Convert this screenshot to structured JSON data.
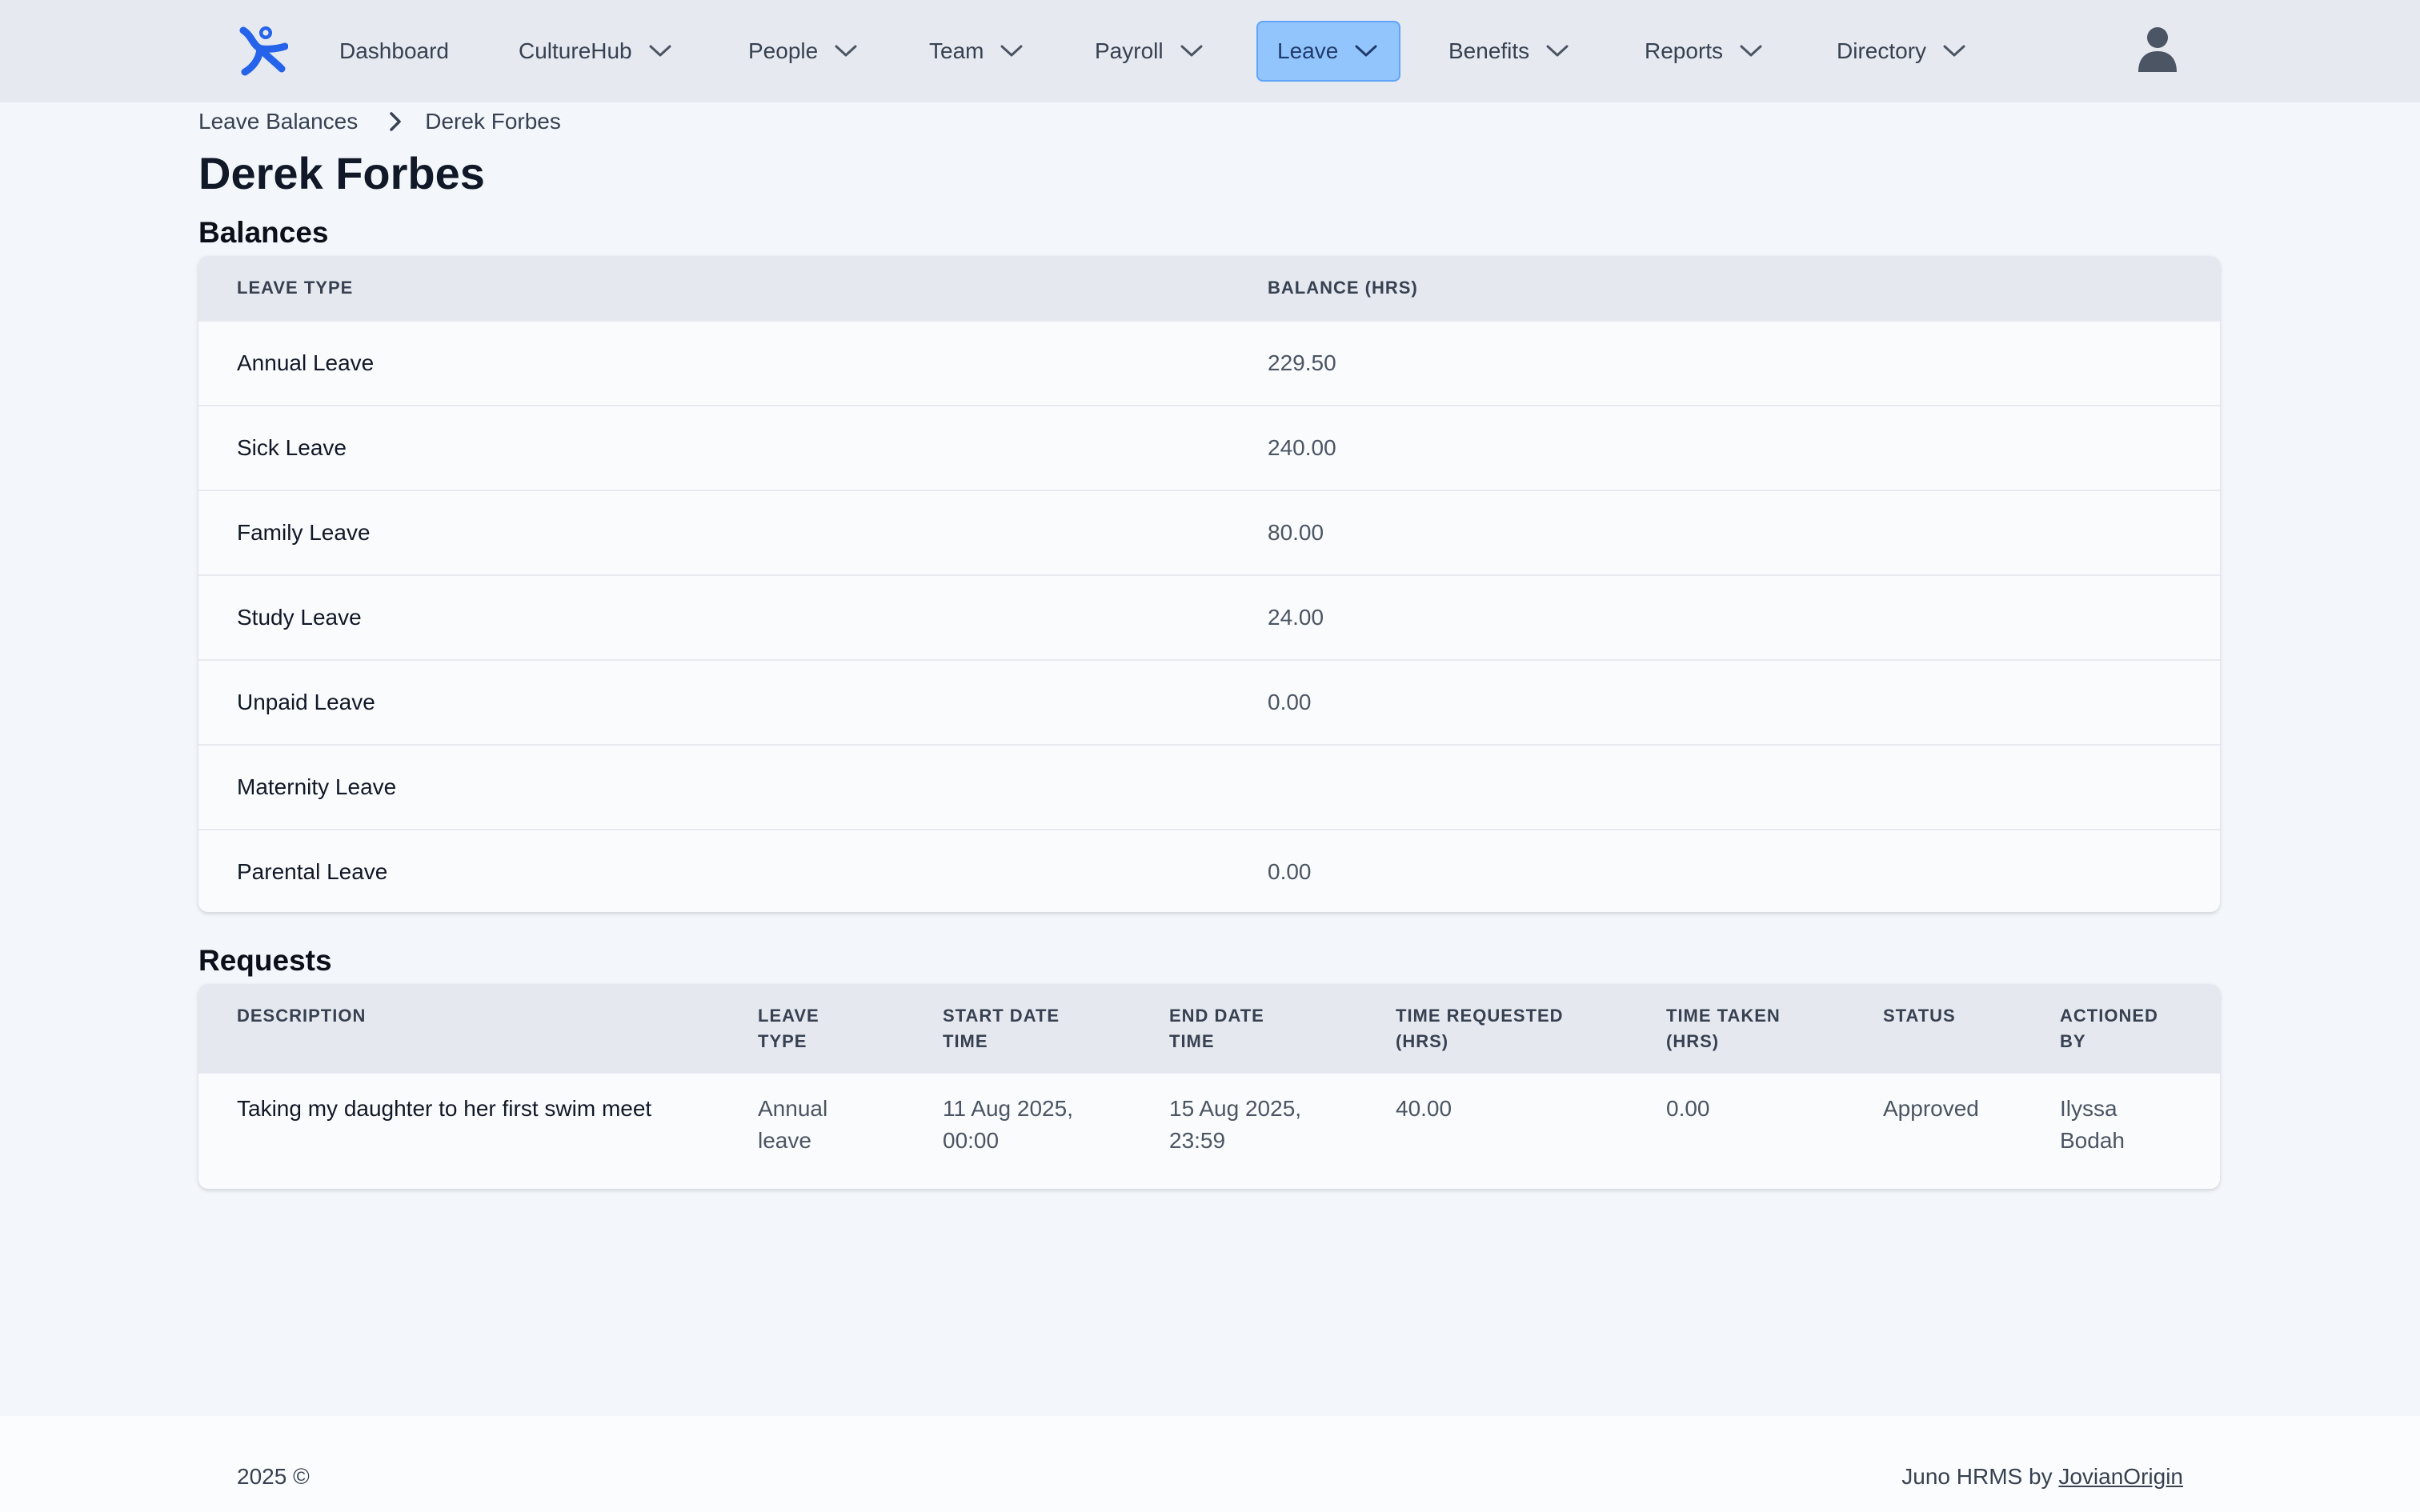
{
  "nav": {
    "items": [
      {
        "label": "Dashboard",
        "dropdown": false,
        "active": false
      },
      {
        "label": "CultureHub",
        "dropdown": true,
        "active": false
      },
      {
        "label": "People",
        "dropdown": true,
        "active": false
      },
      {
        "label": "Team",
        "dropdown": true,
        "active": false
      },
      {
        "label": "Payroll",
        "dropdown": true,
        "active": false
      },
      {
        "label": "Leave",
        "dropdown": true,
        "active": true
      },
      {
        "label": "Benefits",
        "dropdown": true,
        "active": false
      },
      {
        "label": "Reports",
        "dropdown": true,
        "active": false
      },
      {
        "label": "Directory",
        "dropdown": true,
        "active": false
      }
    ],
    "logo_icon": "juno-logo-icon",
    "user_icon": "user-avatar-icon",
    "accent_color": "#93c5fd",
    "brand_color": "#2563eb"
  },
  "breadcrumb": {
    "parent": "Leave Balances",
    "current": "Derek Forbes"
  },
  "page_title": "Derek Forbes",
  "balances": {
    "title": "Balances",
    "headers": {
      "leave_type": "LEAVE TYPE",
      "balance": "BALANCE (HRS)"
    },
    "rows": [
      {
        "type": "Annual Leave",
        "balance": "229.50"
      },
      {
        "type": "Sick Leave",
        "balance": "240.00"
      },
      {
        "type": "Family Leave",
        "balance": "80.00"
      },
      {
        "type": "Study Leave",
        "balance": "24.00"
      },
      {
        "type": "Unpaid Leave",
        "balance": "0.00"
      },
      {
        "type": "Maternity Leave",
        "balance": ""
      },
      {
        "type": "Parental Leave",
        "balance": "0.00"
      }
    ]
  },
  "requests": {
    "title": "Requests",
    "headers": {
      "description": "DESCRIPTION",
      "leave_type_1": "LEAVE",
      "leave_type_2": "TYPE",
      "start_1": "START DATE",
      "start_2": "TIME",
      "end_1": "END DATE",
      "end_2": "TIME",
      "requested_1": "TIME REQUESTED",
      "requested_2": "(HRS)",
      "taken_1": "TIME TAKEN",
      "taken_2": "(HRS)",
      "status": "STATUS",
      "actioned_1": "ACTIONED",
      "actioned_2": "BY"
    },
    "rows": [
      {
        "description": "Taking my daughter to her first swim meet",
        "leave_type_1": "Annual",
        "leave_type_2": "leave",
        "start_1": "11 Aug 2025,",
        "start_2": "00:00",
        "end_1": "15 Aug 2025,",
        "end_2": "23:59",
        "requested": "40.00",
        "taken": "0.00",
        "status": "Approved",
        "actioned_1": "Ilyssa",
        "actioned_2": "Bodah"
      }
    ]
  },
  "footer": {
    "left": "2025 ©",
    "right_prefix": "Juno HRMS by",
    "right_link": "JovianOrigin"
  }
}
